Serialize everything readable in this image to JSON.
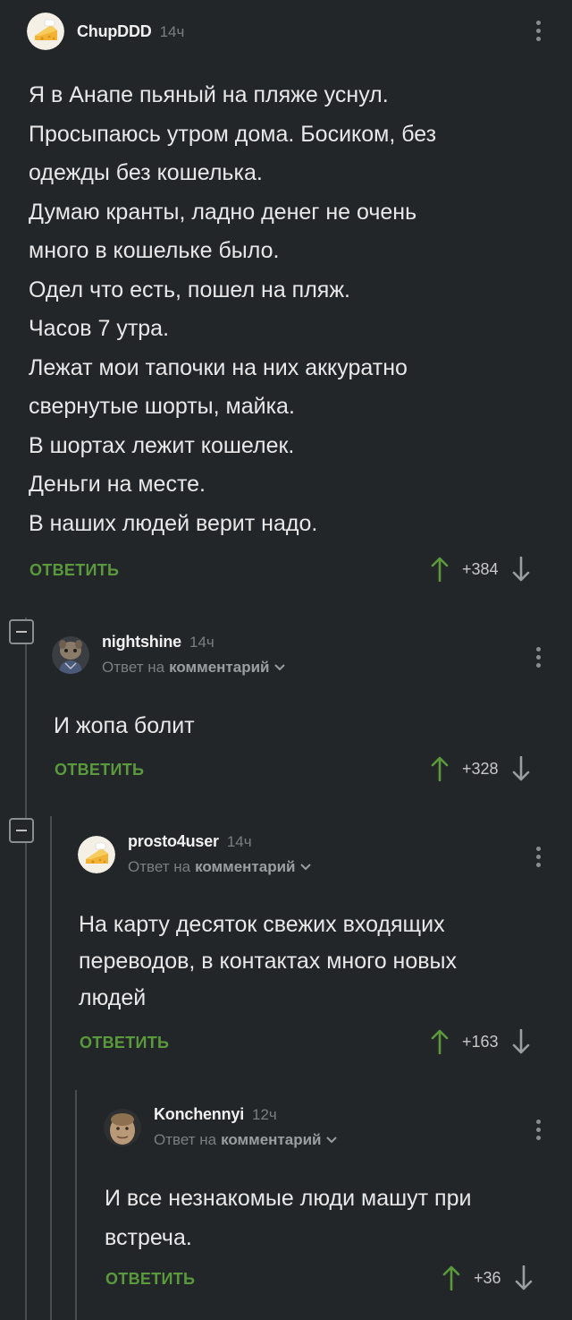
{
  "colors": {
    "background": "#232629",
    "reply_green": "#5a9a3c",
    "upvote_green": "#5a9a3c",
    "muted": "#7a7e82",
    "thread_line": "#4a4d50"
  },
  "comments": [
    {
      "username": "ChupDDD",
      "time": "14ч",
      "avatar_icon": "cheese-avatar",
      "lines": [
        "Я в Анапе пьяный на пляже уснул.",
        "Просыпаюсь утром дома. Босиком, без",
        "одежды без кошелька.",
        "Думаю кранты, ладно денег не очень",
        "много в кошельке было.",
        "Одел что есть, пошел на пляж.",
        "Часов 7 утра.",
        "Лежат мои тапочки на них аккуратно",
        "свернутые шорты, майка.",
        "В шортах лежит кошелек.",
        "Деньги на месте.",
        "В наших людей верит надо."
      ],
      "reply_label": "ОТВЕТИТЬ",
      "score": "+384"
    },
    {
      "username": "nightshine",
      "time": "14ч",
      "avatar_icon": "creature-avatar",
      "reply_to_prefix": "Ответ на",
      "reply_to_link": "комментарий",
      "lines": [
        "И жопа болит"
      ],
      "reply_label": "ОТВЕТИТЬ",
      "score": "+328"
    },
    {
      "username": "prosto4user",
      "time": "14ч",
      "avatar_icon": "cheese-avatar",
      "reply_to_prefix": "Ответ на",
      "reply_to_link": "комментарий",
      "lines": [
        "На карту десяток свежих входящих",
        "переводов, в контактах много новых",
        "людей"
      ],
      "reply_label": "ОТВЕТИТЬ",
      "score": "+163"
    },
    {
      "username": "Konchennyi",
      "time": "12ч",
      "avatar_icon": "face-avatar",
      "reply_to_prefix": "Ответ на",
      "reply_to_link": "комментарий",
      "lines": [
        "И все незнакомые люди машут при",
        "встреча."
      ],
      "reply_label": "ОТВЕТИТЬ",
      "score": "+36"
    }
  ]
}
